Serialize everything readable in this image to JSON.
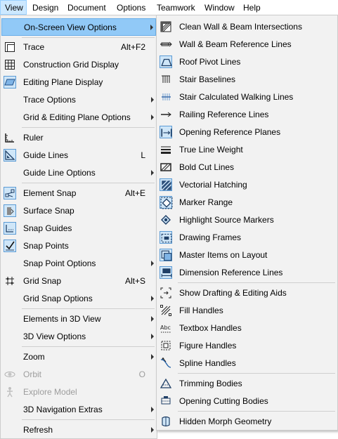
{
  "menubar": [
    "View",
    "Design",
    "Document",
    "Options",
    "Teamwork",
    "Window",
    "Help"
  ],
  "colors": {
    "highlight": "#91c9f7",
    "accent": "#5b9bd5",
    "menu_bg": "#f2f2f2",
    "disabled_text": "#9d9d9d"
  },
  "view_menu": {
    "items": [
      {
        "label": "On-Screen View Options",
        "has_submenu": true,
        "highlighted": true
      },
      {
        "label": "Trace",
        "shortcut": "Alt+F2",
        "icon": "trace-icon"
      },
      {
        "label": "Construction Grid Display",
        "icon": "construction-grid-icon"
      },
      {
        "label": "Editing Plane Display",
        "icon": "editing-plane-icon"
      },
      {
        "label": "Trace Options",
        "has_submenu": true
      },
      {
        "label": "Grid & Editing Plane Options",
        "has_submenu": true
      },
      {
        "label": "Ruler",
        "icon": "ruler-icon"
      },
      {
        "label": "Guide Lines",
        "shortcut": "L",
        "icon": "guide-lines-icon"
      },
      {
        "label": "Guide Line Options",
        "has_submenu": true
      },
      {
        "label": "Element Snap",
        "shortcut": "Alt+E",
        "icon": "element-snap-icon"
      },
      {
        "label": "Surface Snap",
        "icon": "surface-snap-icon"
      },
      {
        "label": "Snap Guides",
        "icon": "snap-guides-icon"
      },
      {
        "label": "Snap Points",
        "icon": "snap-points-icon"
      },
      {
        "label": "Snap Point Options",
        "has_submenu": true
      },
      {
        "label": "Grid Snap",
        "shortcut": "Alt+S",
        "icon": "grid-snap-icon"
      },
      {
        "label": "Grid Snap Options",
        "has_submenu": true
      },
      {
        "label": "Elements in 3D View",
        "has_submenu": true
      },
      {
        "label": "3D View Options",
        "has_submenu": true
      },
      {
        "label": "Zoom",
        "has_submenu": true
      },
      {
        "label": "Orbit",
        "shortcut": "O",
        "icon": "orbit-icon",
        "disabled": true
      },
      {
        "label": "Explore Model",
        "icon": "explore-model-icon",
        "disabled": true
      },
      {
        "label": "3D Navigation Extras",
        "has_submenu": true
      },
      {
        "label": "Refresh",
        "has_submenu": true
      }
    ]
  },
  "onscreen_submenu": {
    "items": [
      {
        "label": "Clean Wall & Beam Intersections",
        "icon": "clean-intersections-icon"
      },
      {
        "label": "Wall & Beam Reference Lines",
        "icon": "reference-lines-icon"
      },
      {
        "label": "Roof Pivot Lines",
        "icon": "roof-pivot-icon"
      },
      {
        "label": "Stair Baselines",
        "icon": "stair-baselines-icon"
      },
      {
        "label": "Stair Calculated Walking Lines",
        "icon": "walking-lines-icon"
      },
      {
        "label": "Railing Reference Lines",
        "icon": "railing-reference-icon"
      },
      {
        "label": "Opening Reference Planes",
        "icon": "opening-planes-icon"
      },
      {
        "label": "True Line Weight",
        "icon": "line-weight-icon"
      },
      {
        "label": "Bold Cut Lines",
        "icon": "bold-cut-icon"
      },
      {
        "label": "Vectorial Hatching",
        "icon": "vectorial-hatching-icon"
      },
      {
        "label": "Marker Range",
        "icon": "marker-range-icon"
      },
      {
        "label": "Highlight Source Markers",
        "icon": "source-markers-icon"
      },
      {
        "label": "Drawing Frames",
        "icon": "drawing-frames-icon"
      },
      {
        "label": "Master Items on Layout",
        "icon": "master-items-icon"
      },
      {
        "label": "Dimension Reference Lines",
        "icon": "dimension-reference-icon"
      },
      {
        "label": "Show Drafting & Editing Aids",
        "icon": "drafting-aids-icon"
      },
      {
        "label": "Fill Handles",
        "icon": "fill-handles-icon"
      },
      {
        "label": "Textbox Handles",
        "icon": "textbox-handles-icon"
      },
      {
        "label": "Figure Handles",
        "icon": "figure-handles-icon"
      },
      {
        "label": "Spline Handles",
        "icon": "spline-handles-icon"
      },
      {
        "label": "Trimming Bodies",
        "icon": "trimming-bodies-icon"
      },
      {
        "label": "Opening Cutting Bodies",
        "icon": "cutting-bodies-icon"
      },
      {
        "label": "Hidden Morph Geometry",
        "icon": "morph-geometry-icon"
      }
    ]
  }
}
